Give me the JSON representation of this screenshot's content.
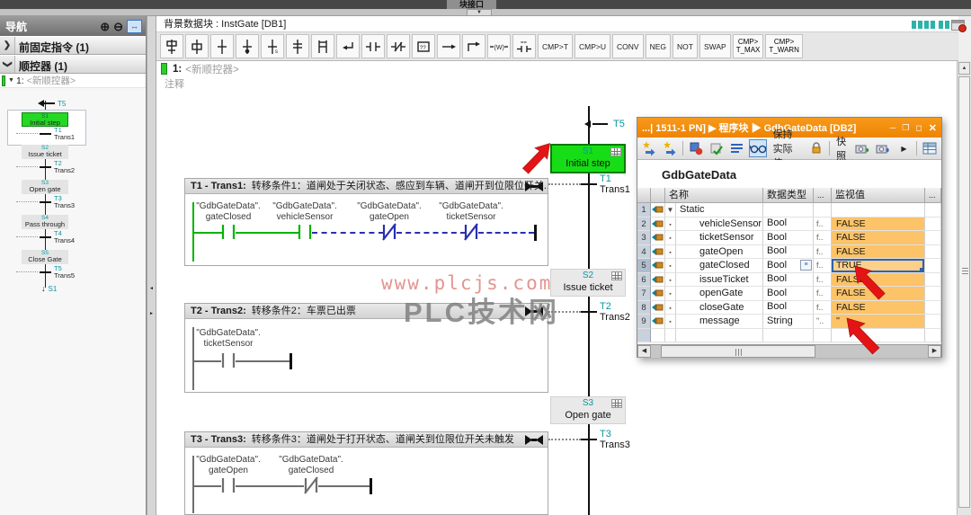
{
  "colors": {
    "accent_orange": "#f08a00",
    "step_green": "#17dd17",
    "value_cell_orange": "#fcc368",
    "id_teal": "#0a96a2",
    "monitor_green": "#00b400",
    "monitor_blue_dashed": "#2830b0",
    "annotation_red": "#e41414"
  },
  "window": {
    "top_tab": "块接口",
    "instance_db": "背景数据块 : InstGate [DB1]"
  },
  "nav": {
    "title": "导航",
    "sections": [
      {
        "label": "前固定指令 (1)"
      },
      {
        "label": "顺控器 (1)"
      }
    ],
    "tree_item_num": "1:",
    "tree_item_name": "<新顺控器>",
    "overview": {
      "entry_transition": "T5",
      "exit_step": "S1",
      "steps": [
        {
          "id": "S1",
          "label": "Initial step"
        },
        {
          "id": "S2",
          "label": "Issue ticket"
        },
        {
          "id": "S3",
          "label": "Open gate"
        },
        {
          "id": "S4",
          "label": "Pass through"
        },
        {
          "id": "S5",
          "label": "Close Gate"
        }
      ],
      "transitions": [
        {
          "id": "T1",
          "label": "Trans1"
        },
        {
          "id": "T2",
          "label": "Trans2"
        },
        {
          "id": "T3",
          "label": "Trans3"
        },
        {
          "id": "T4",
          "label": "Trans4"
        },
        {
          "id": "T5",
          "label": "Trans5"
        }
      ]
    }
  },
  "editor": {
    "toolbar": {
      "cmp_buttons": [
        "CMP>T",
        "CMP>U",
        "CONV",
        "NEG",
        "NOT",
        "SWAP"
      ],
      "tmax": {
        "l1": "CMP>",
        "l2": "T_MAX"
      },
      "twarn": {
        "l1": "CMP>",
        "l2": "T_WARN"
      }
    },
    "sequence": {
      "number": "1:",
      "name": "<新顺控器>",
      "comment": "注释"
    }
  },
  "canvas": {
    "entry_transition": "T5",
    "steps": [
      {
        "id": "S1",
        "label": "Initial step"
      },
      {
        "id": "S2",
        "label": "Issue ticket"
      },
      {
        "id": "S3",
        "label": "Open gate"
      }
    ],
    "transitions": [
      {
        "id": "T1",
        "label": "Trans1"
      },
      {
        "id": "T2",
        "label": "Trans2"
      },
      {
        "id": "T3",
        "label": "Trans3"
      }
    ],
    "networks": [
      {
        "id": "T1 - Trans1:",
        "comment": "转移条件1：道闸处于关闭状态、感应到车辆、道闸开到位限位开关...",
        "contacts": [
          {
            "o1": "\"GdbGateData\".",
            "o2": "gateClosed"
          },
          {
            "o1": "\"GdbGateData\".",
            "o2": "vehicleSensor"
          },
          {
            "o1": "\"GdbGateData\".",
            "o2": "gateOpen"
          },
          {
            "o1": "\"GdbGateData\".",
            "o2": "ticketSensor"
          }
        ]
      },
      {
        "id": "T2 - Trans2:",
        "comment": "转移条件2：车票已出票",
        "contacts": [
          {
            "o1": "\"GdbGateData\".",
            "o2": "ticketSensor"
          }
        ]
      },
      {
        "id": "T3 - Trans3:",
        "comment": "转移条件3：道闸处于打开状态、道闸关到位限位开关未触发",
        "contacts": [
          {
            "o1": "\"GdbGateData\".",
            "o2": "gateOpen"
          },
          {
            "o1": "\"GdbGateData\".",
            "o2": "gateClosed"
          }
        ]
      }
    ]
  },
  "watermark": {
    "line1": "www.plcjs.com",
    "line2": "PLC技术网"
  },
  "watch": {
    "title": "...| 1511-1 PN] ▶ 程序块 ▶ GdbGateData [DB2]",
    "toolbar": {
      "keep_actual_label": "保持实际值",
      "snapshot_label": "快照"
    },
    "block_name": "GdbGateData",
    "columns": {
      "name": "名称",
      "type": "数据类型",
      "dots1": "...",
      "value": "监视值",
      "dots2": "..."
    },
    "rows": [
      {
        "num": "1",
        "name": "Static",
        "type": "",
        "def": "",
        "value": "",
        "group": true,
        "has_icon": true
      },
      {
        "num": "2",
        "name": "vehicleSensor",
        "type": "Bool",
        "def": "f..",
        "value": "FALSE",
        "leaf": true,
        "mon": true,
        "has_icon": true
      },
      {
        "num": "3",
        "name": "ticketSensor",
        "type": "Bool",
        "def": "f..",
        "value": "FALSE",
        "leaf": true,
        "mon": true,
        "has_icon": true
      },
      {
        "num": "4",
        "name": "gateOpen",
        "type": "Bool",
        "def": "f..",
        "value": "FALSE",
        "leaf": true,
        "mon": true,
        "has_icon": true
      },
      {
        "num": "5",
        "name": "gateClosed",
        "type": "Bool",
        "def": "f..",
        "value": "TRUE",
        "leaf": true,
        "mon": true,
        "selected": true,
        "has_btn": true,
        "has_icon": true
      },
      {
        "num": "6",
        "name": "issueTicket",
        "type": "Bool",
        "def": "f..",
        "value": "FALSE",
        "leaf": true,
        "mon": true,
        "has_icon": true
      },
      {
        "num": "7",
        "name": "openGate",
        "type": "Bool",
        "def": "f..",
        "value": "FALSE",
        "leaf": true,
        "mon": true,
        "has_icon": true
      },
      {
        "num": "8",
        "name": "closeGate",
        "type": "Bool",
        "def": "f..",
        "value": "FALSE",
        "leaf": true,
        "mon": true,
        "has_icon": true
      },
      {
        "num": "9",
        "name": "message",
        "type": "String",
        "def": "\"..",
        "value": "''",
        "leaf": true,
        "mon": true,
        "has_icon": true
      },
      {
        "num": "",
        "name": "",
        "type": "",
        "def": "",
        "value": ""
      }
    ]
  }
}
